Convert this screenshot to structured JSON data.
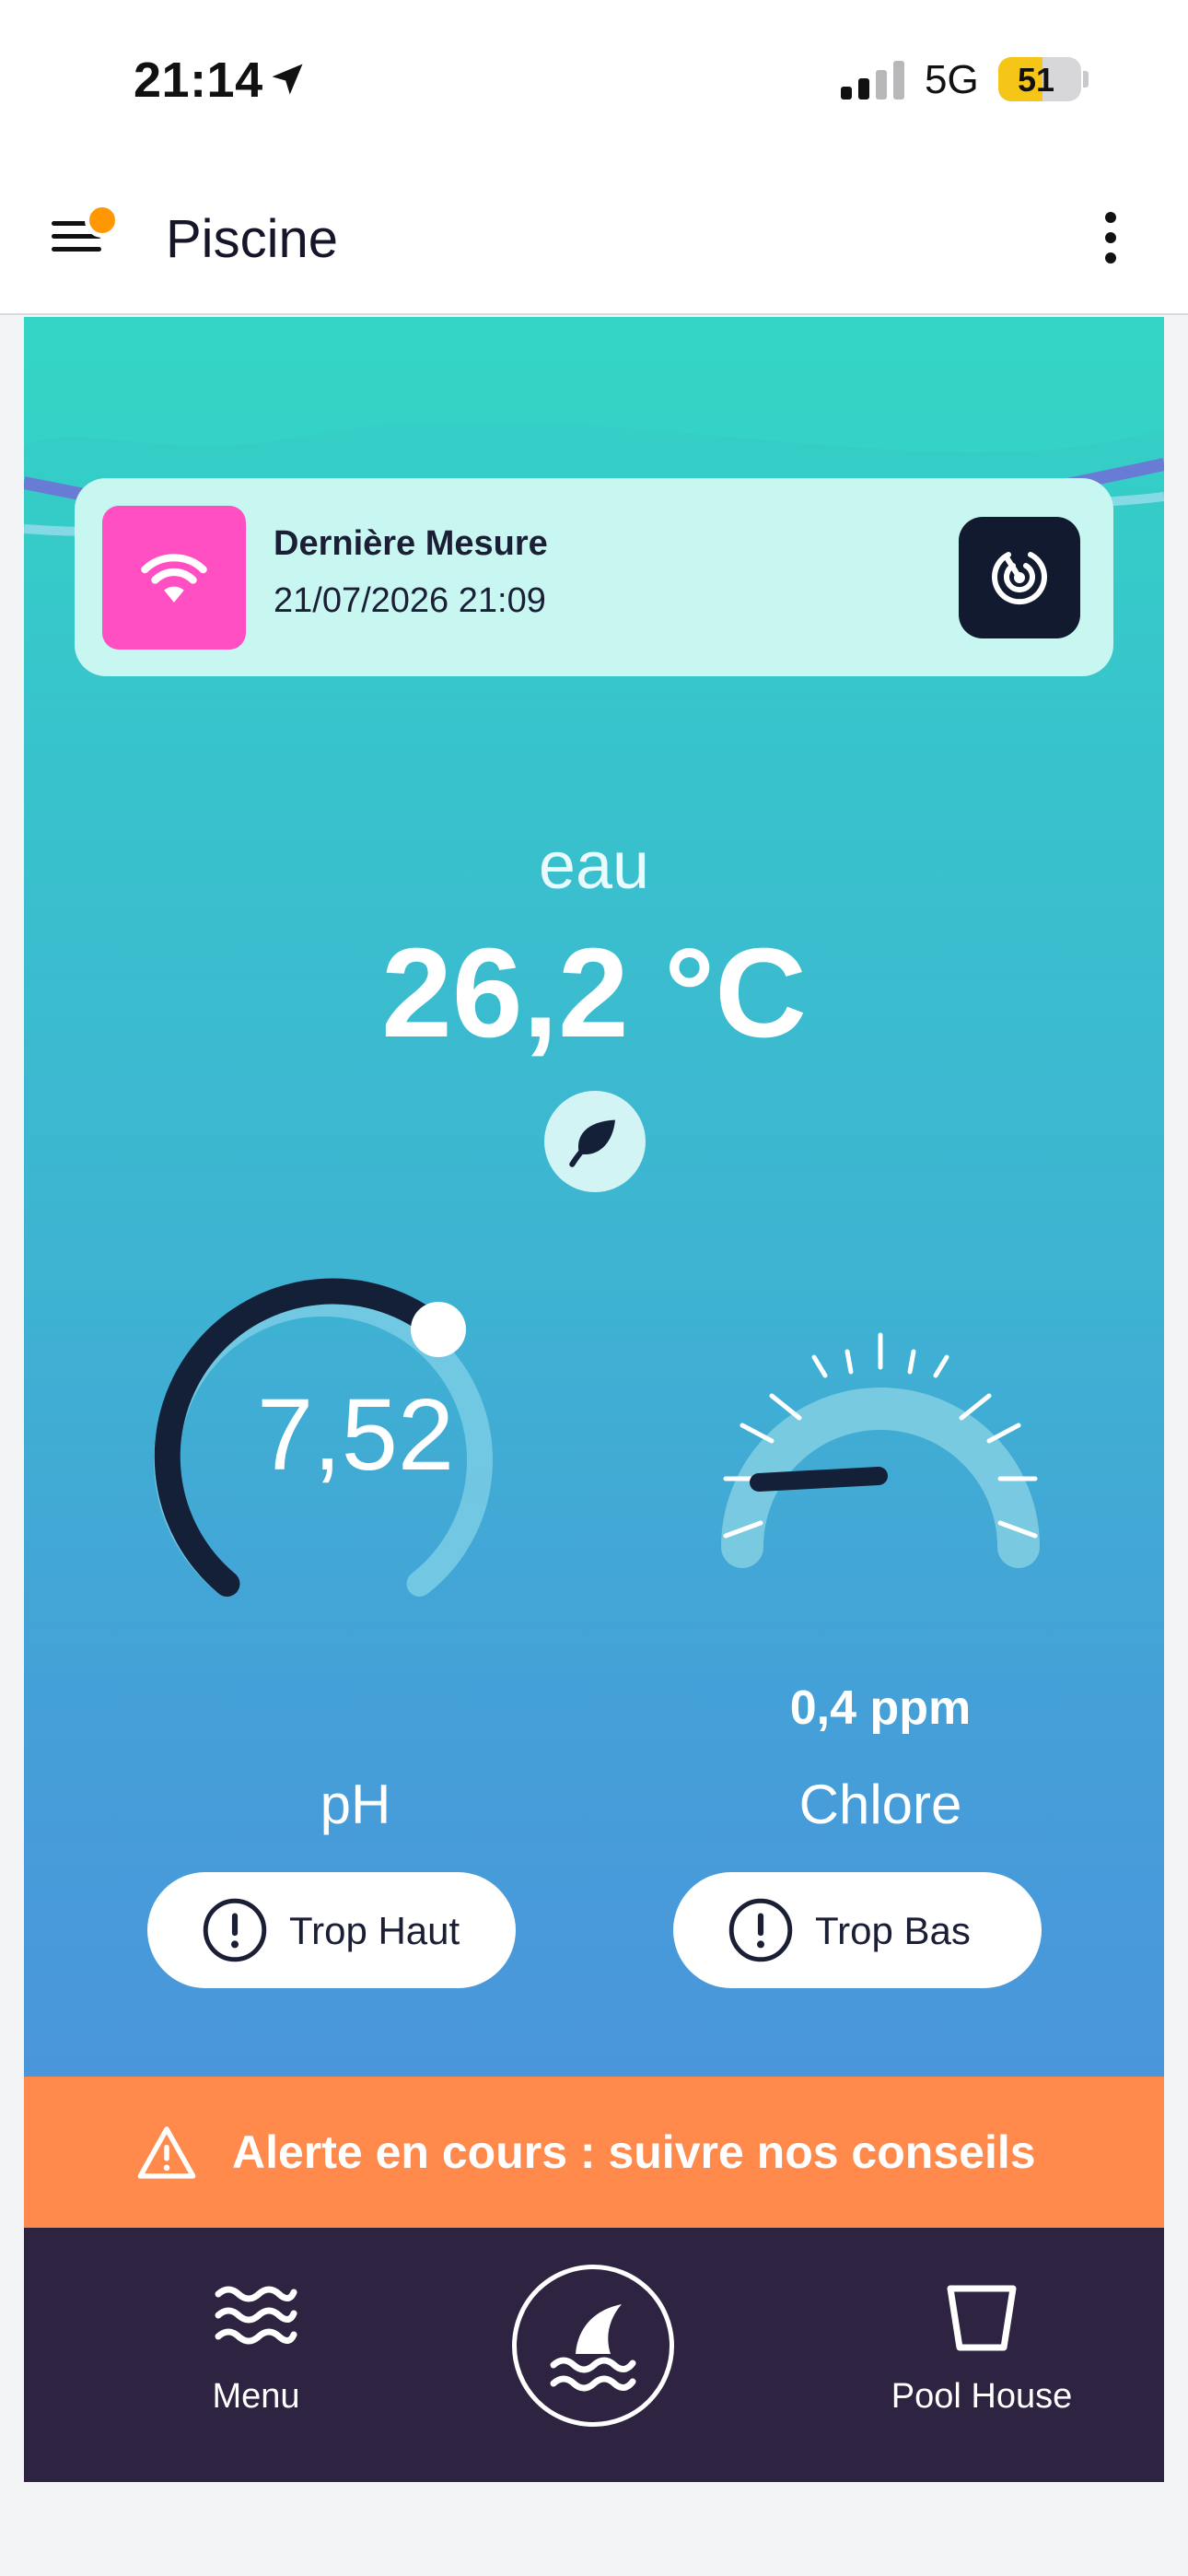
{
  "status_bar": {
    "time": "21:14",
    "network": "5G",
    "battery": "51"
  },
  "header": {
    "title": "Piscine"
  },
  "last_measure": {
    "label": "Dernière Mesure",
    "datetime": "21/07/2026 21:09"
  },
  "water": {
    "label": "eau",
    "temperature": "26,2 °C"
  },
  "ph": {
    "value": "7,52",
    "label": "pH",
    "status": "Trop Haut"
  },
  "chlorine": {
    "value": "0,4 ppm",
    "label": "Chlore",
    "status": "Trop Bas"
  },
  "alert": {
    "text": "Alerte en cours : suivre nos conseils"
  },
  "bottom_nav": {
    "menu_label": "Menu",
    "pool_house_label": "Pool House"
  },
  "colors": {
    "accent_pink": "#ff4fc2",
    "alert_orange": "#ff8a4c",
    "nav_bg": "#2e2340",
    "notification_dot": "#ff9800",
    "gauge_dark": "#142037"
  },
  "icons": [
    "location-arrow-icon",
    "signal-icon",
    "hamburger-icon",
    "more-vert-icon",
    "wifi-icon",
    "measure-icon",
    "leaf-icon",
    "warning-circle-icon",
    "warning-triangle-icon",
    "waves-icon",
    "shark-fin-icon",
    "bucket-icon"
  ]
}
